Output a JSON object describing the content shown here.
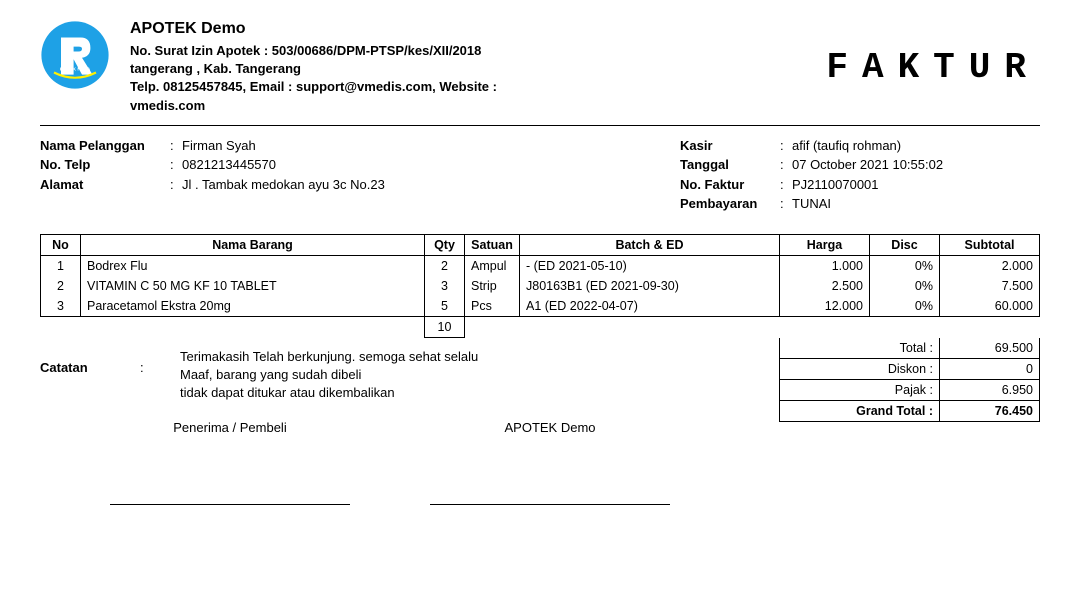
{
  "header": {
    "company_name": "APOTEK Demo",
    "license_line": "No. Surat Izin Apotek : 503/00686/DPM-PTSP/kes/XII/2018",
    "address_line": "tangerang , Kab. Tangerang",
    "contact_line": "Telp. 08125457845, Email : support@vmedis.com, Website : vmedis.com",
    "doc_title": "FAKTUR"
  },
  "customer": {
    "name_label": "Nama Pelanggan",
    "name": "Firman Syah",
    "phone_label": "No. Telp",
    "phone": "0821213445570",
    "address_label": "Alamat",
    "address": "Jl . Tambak medokan ayu 3c No.23"
  },
  "invoice": {
    "cashier_label": "Kasir",
    "cashier": "afif (taufiq rohman)",
    "date_label": "Tanggal",
    "date": "07 October 2021 10:55:02",
    "no_label": "No. Faktur",
    "no": "PJ2110070001",
    "payment_label": "Pembayaran",
    "payment": "TUNAI"
  },
  "columns": {
    "no": "No",
    "name": "Nama Barang",
    "qty": "Qty",
    "unit": "Satuan",
    "batch": "Batch & ED",
    "price": "Harga",
    "disc": "Disc",
    "subtotal": "Subtotal"
  },
  "items": [
    {
      "no": "1",
      "name": "Bodrex Flu",
      "qty": "2",
      "unit": "Ampul",
      "batch": "- (ED 2021-05-10)",
      "price": "1.000",
      "disc": "0%",
      "subtotal": "2.000"
    },
    {
      "no": "2",
      "name": "VITAMIN C 50 MG KF 10 TABLET",
      "qty": "3",
      "unit": "Strip",
      "batch": "J80163B1 (ED 2021-09-30)",
      "price": "2.500",
      "disc": "0%",
      "subtotal": "7.500"
    },
    {
      "no": "3",
      "name": "Paracetamol Ekstra 20mg",
      "qty": "5",
      "unit": "Pcs",
      "batch": "A1 (ED 2022-04-07)",
      "price": "12.000",
      "disc": "0%",
      "subtotal": "60.000"
    }
  ],
  "qty_total": "10",
  "summary": {
    "total_label": "Total :",
    "total": "69.500",
    "discount_label": "Diskon :",
    "discount": "0",
    "tax_label": "Pajak :",
    "tax": "6.950",
    "grand_label": "Grand Total :",
    "grand": "76.450"
  },
  "notes": {
    "label": "Catatan",
    "line1": "Terimakasih Telah berkunjung. semoga sehat selalu",
    "line2": "Maaf, barang yang sudah dibeli",
    "line3": "tidak dapat ditukar atau dikembalikan"
  },
  "signatures": {
    "receiver": "Penerima / Pembeli",
    "company": "APOTEK Demo"
  }
}
